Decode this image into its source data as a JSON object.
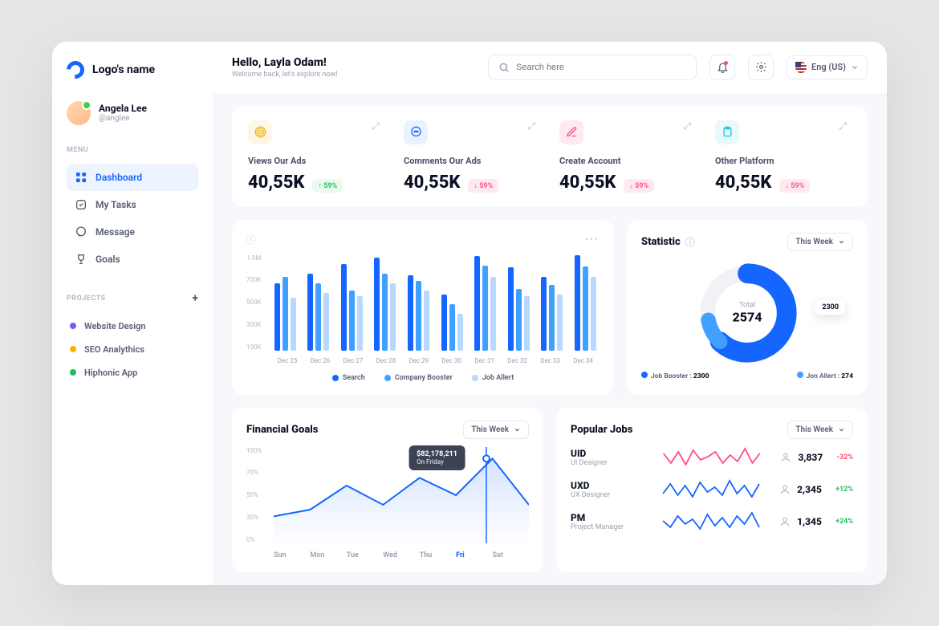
{
  "logo": {
    "text": "Logo's name"
  },
  "profile": {
    "name": "Angela Lee",
    "handle": "@anglee"
  },
  "menu_label": "MENU",
  "menu": [
    {
      "label": "Dashboard",
      "active": true
    },
    {
      "label": "My Tasks",
      "active": false
    },
    {
      "label": "Message",
      "active": false
    },
    {
      "label": "Goals",
      "active": false
    }
  ],
  "projects_label": "PROJECTS",
  "projects": [
    {
      "label": "Website Design",
      "color": "#6f5cff"
    },
    {
      "label": "SEO Analythics",
      "color": "#f7b500"
    },
    {
      "label": "Hiphonic App",
      "color": "#1fbf5f"
    }
  ],
  "header": {
    "greeting": "Hello, Layla Odam!",
    "subtitle": "Welcome back, let's explore now!",
    "search_placeholder": "Search here",
    "language": "Eng (US)"
  },
  "stats": [
    {
      "label": "Views Our Ads",
      "value": "40,55K",
      "delta": "59%",
      "dir": "up",
      "icon_bg": "#fff6e6",
      "icon_color": "#f7b500"
    },
    {
      "label": "Comments Our Ads",
      "value": "40,55K",
      "delta": "59%",
      "dir": "down",
      "icon_bg": "#eaf2ff",
      "icon_color": "#1565ff"
    },
    {
      "label": "Create Account",
      "value": "40,55K",
      "delta": "59%",
      "dir": "down",
      "icon_bg": "#ffe9f1",
      "icon_color": "#ff4b8e"
    },
    {
      "label": "Other Platform",
      "value": "40,55K",
      "delta": "59%",
      "dir": "down",
      "icon_bg": "#e6f9fb",
      "icon_color": "#1cc2d9"
    }
  ],
  "chart_data": {
    "bar_chart": {
      "type": "bar",
      "ylabel": "",
      "y_ticks": [
        "1.0M",
        "700K",
        "500K",
        "300K",
        "100K"
      ],
      "ylim_k": [
        0,
        1000
      ],
      "categories": [
        "Dec 25",
        "Dec 26",
        "Dec 27",
        "Dec 28",
        "Dec 29",
        "Dec 30",
        "Dec 31",
        "Dec 32",
        "Dec 33",
        "Dec 34"
      ],
      "series": [
        {
          "name": "Search",
          "color": "#1565ff",
          "values_k": [
            700,
            800,
            900,
            960,
            780,
            580,
            980,
            860,
            760,
            990
          ]
        },
        {
          "name": "Company Booster",
          "color": "#3fa0ff",
          "values_k": [
            760,
            700,
            620,
            800,
            720,
            480,
            880,
            640,
            680,
            870
          ]
        },
        {
          "name": "Job Allert",
          "color": "#b9d8ff",
          "values_k": [
            550,
            600,
            560,
            700,
            620,
            380,
            760,
            560,
            580,
            760
          ]
        }
      ]
    },
    "donut": {
      "type": "pie",
      "title": "Statistic",
      "center_label": "Total",
      "center_value": "2574",
      "badge": "2300",
      "series": [
        {
          "name": "Job Booster",
          "value": 2300,
          "color": "#1565ff"
        },
        {
          "name": "Jon Allert",
          "value": 274,
          "color": "#3fa0ff"
        }
      ]
    },
    "financial": {
      "type": "line",
      "title": "Financial Goals",
      "selector": "This Week",
      "y_ticks": [
        "100%",
        "70%",
        "50%",
        "30%",
        "0%"
      ],
      "categories": [
        "Sun",
        "Mon",
        "Tue",
        "Wed",
        "Thu",
        "Fri",
        "Sat"
      ],
      "values_pct": [
        28,
        35,
        60,
        40,
        68,
        50,
        88,
        40
      ],
      "tooltip": {
        "value": "$82,178,211",
        "sub": "On Friday"
      }
    },
    "popular_jobs": {
      "title": "Popular Jobs",
      "selector": "This Week",
      "items": [
        {
          "short": "UID",
          "full": "UI Designer",
          "count": "3,837",
          "delta": "-32%",
          "dir": "neg",
          "spark_color": "#ff4b8e",
          "spark": [
            18,
            6,
            20,
            4,
            22,
            10,
            14,
            20,
            6,
            16,
            8,
            24,
            6,
            18
          ]
        },
        {
          "short": "UXD",
          "full": "UX Designer",
          "count": "2,345",
          "delta": "+12%",
          "dir": "pos",
          "spark_color": "#1565ff",
          "spark": [
            8,
            20,
            6,
            18,
            4,
            22,
            10,
            16,
            6,
            24,
            8,
            18,
            4,
            20
          ]
        },
        {
          "short": "PM",
          "full": "Project Manager",
          "count": "1,345",
          "delta": "+24%",
          "dir": "pos",
          "spark_color": "#1565ff",
          "spark": [
            14,
            6,
            20,
            10,
            16,
            4,
            22,
            8,
            18,
            6,
            20,
            10,
            24,
            6
          ]
        }
      ]
    }
  },
  "statistic_selector": "This Week"
}
